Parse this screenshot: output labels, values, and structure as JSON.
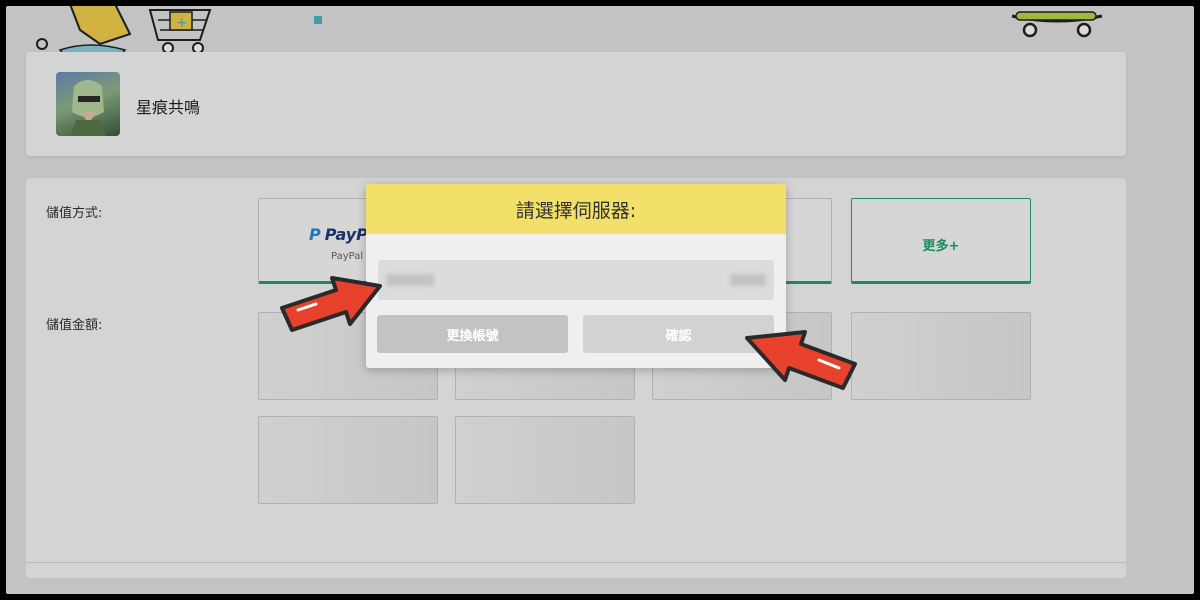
{
  "game": {
    "title": "星痕共鳴"
  },
  "payment": {
    "method_label": "儲值方式:",
    "amount_label": "儲值金額:",
    "methods": [
      {
        "logo": "PayPal",
        "caption": "PayPal"
      },
      {
        "label": "更多+"
      }
    ]
  },
  "modal": {
    "title": "請選擇伺服器:",
    "switch_account_label": "更換帳號",
    "confirm_label": "確認"
  },
  "colors": {
    "modal_header": "#f2e06a",
    "accent_green": "#22a46a",
    "arrow_red": "#e8412c"
  }
}
